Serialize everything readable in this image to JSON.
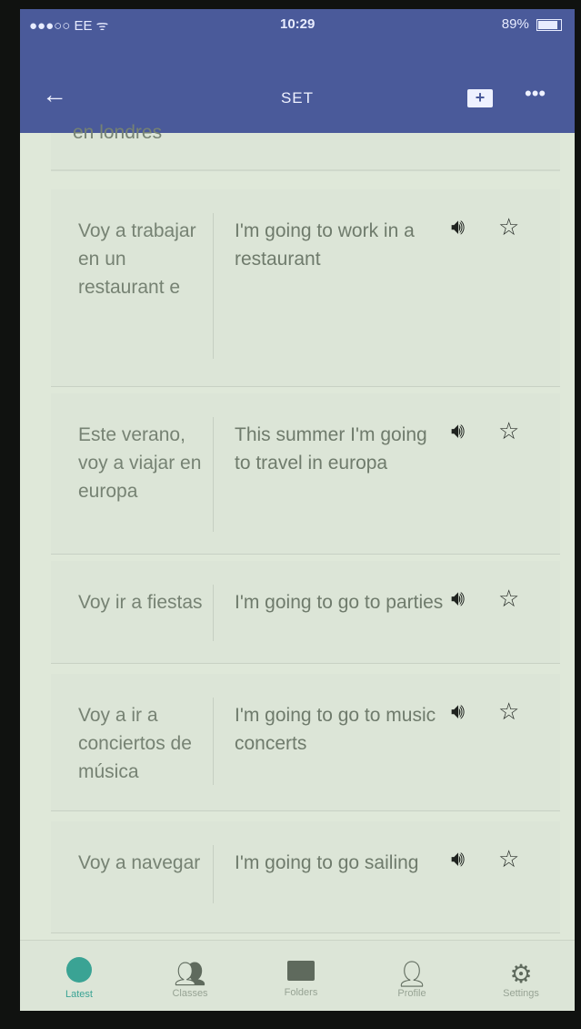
{
  "status_bar": {
    "carrier": "●●●○○ EE ᯤ",
    "time": "10:29",
    "battery": "89%"
  },
  "nav": {
    "back_icon": "arrow-left-icon",
    "title": "SET",
    "add_to_folder_icon": "folder-plus-icon",
    "more_icon": "more-dots-icon"
  },
  "partial_card_text": "en londres",
  "cards": [
    {
      "term": "Voy a trabajar en un restaurant e",
      "definition": "I'm going to work in a restaurant"
    },
    {
      "term": "Este verano, voy a viajar en europa",
      "definition": "This summer I'm going to travel in europa"
    },
    {
      "term": "Voy ir a fiestas",
      "definition": "I'm going to go to parties"
    },
    {
      "term": "Voy a ir a conciertos de música",
      "definition": "I'm going to go to music concerts"
    },
    {
      "term": "Voy a navegar",
      "definition": "I'm going to go sailing"
    }
  ],
  "card_icons": {
    "audio": "speaker-icon",
    "favorite": "star-outline-icon"
  },
  "tabs": [
    {
      "label": "Latest",
      "icon": "clock-icon",
      "active": true
    },
    {
      "label": "Classes",
      "icon": "people-icon",
      "active": false
    },
    {
      "label": "Folders",
      "icon": "folder-icon",
      "active": false
    },
    {
      "label": "Profile",
      "icon": "person-icon",
      "active": false
    },
    {
      "label": "Settings",
      "icon": "gear-icon",
      "active": false
    }
  ],
  "colors": {
    "header": "#4a5a9a",
    "background": "#dfe8d9",
    "accent": "#3aa394"
  }
}
